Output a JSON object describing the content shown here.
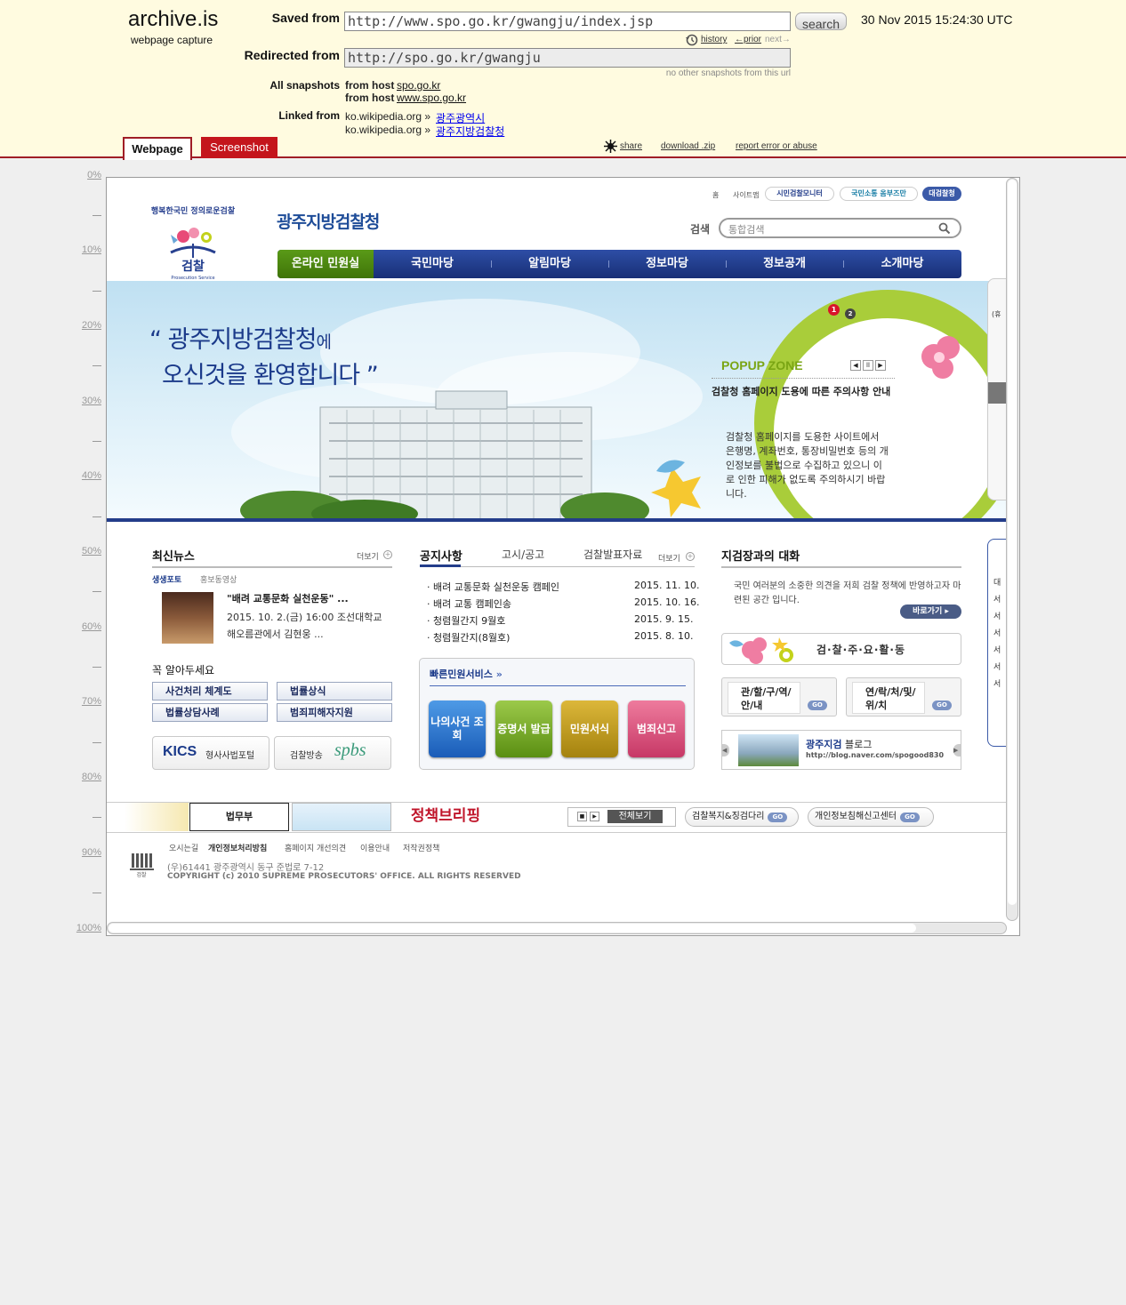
{
  "archive": {
    "logo": "archive.is",
    "logo_sub": "webpage capture",
    "saved_label": "Saved from",
    "saved_url": "http://www.spo.go.kr/gwangju/index.jsp",
    "search_label": "search",
    "timestamp": "30 Nov 2015 15:24:30 UTC",
    "history": "history",
    "prior": "←prior",
    "next": "next→",
    "redirected_label": "Redirected from",
    "redirected_url": "http://spo.go.kr/gwangju",
    "no_other": "no other snapshots from this url",
    "all_snapshots_label": "All snapshots",
    "from_host": "from host",
    "host1": "spo.go.kr",
    "host2": "www.spo.go.kr",
    "linked_label": "Linked from",
    "linked": [
      {
        "prefix": "ko.wikipedia.org »",
        "link": "광주광역시"
      },
      {
        "prefix": "ko.wikipedia.org »",
        "link": "광주지방검찰청"
      }
    ],
    "tab_webpage": "Webpage",
    "tab_screenshot": "Screenshot",
    "share": "share",
    "download": "download .zip",
    "report": "report error or abuse"
  },
  "ruler": [
    "0%",
    "10%",
    "20%",
    "30%",
    "40%",
    "50%",
    "60%",
    "70%",
    "80%",
    "90%",
    "100%"
  ],
  "site": {
    "util_links": [
      "홈",
      "사이트맵"
    ],
    "util_buttons": [
      "시민검찰모니터",
      "국민소통 옴부즈만",
      "대검찰청"
    ],
    "title": "광주지방검찰청",
    "logo_arc": "행복한국민 정의로운검찰",
    "logo_name": "검찰",
    "logo_en": "Prosecution Service",
    "search_label": "검색",
    "search_placeholder": "통합검색",
    "nav": [
      "온라인 민원실",
      "국민마당",
      "알림마당",
      "정보마당",
      "정보공개",
      "소개마당"
    ],
    "welcome_line1": "“ 광주지방검찰청",
    "welcome_line1_suffix": "에",
    "welcome_line2": "오신것을 환영합니다 ”",
    "popup": {
      "title": "POPUP ZONE",
      "pages": [
        "1",
        "2"
      ],
      "heading": "검찰청 홈페이지 도용에 따른 주의사항 안내",
      "body": "검찰청 홈페이지를 도용한 사이트에서 은행명, 계좌번호, 통장비밀번호 등의 개인정보를 불법으로 수집하고 있으니 이로 인한 피해가 없도록 주의하시기 바랍니다."
    },
    "news": {
      "title": "최신뉴스",
      "more": "더보기",
      "tabs": [
        "생생포토",
        "홍보동영상"
      ],
      "headline": "\"배려 교통문화 실천운동\" ...",
      "body": "2015. 10. 2.(금) 16:00 조선대학교 해오름관에서 김현웅 ..."
    },
    "notice": {
      "tabs": [
        "공지사항",
        "고시/공고",
        "검찰발표자료"
      ],
      "more": "더보기",
      "items": [
        {
          "title": "배려 교통문화 실천운동 캠페인",
          "date": "2015. 11. 10."
        },
        {
          "title": "배려 교통 캠페인송",
          "date": "2015. 10. 16."
        },
        {
          "title": "청렴월간지 9월호",
          "date": "2015. 9. 15."
        },
        {
          "title": "청렴월간지(8월호)",
          "date": "2015. 8. 10."
        }
      ]
    },
    "dialog": {
      "title": "지검장과의 대화",
      "body": "국민 여러분의 소중한 의견을 저희 검찰 정책에 반영하고자 마련된 공간 입니다.",
      "button": "바로가기"
    },
    "must_know": {
      "title": "꼭 알아두세요",
      "items": [
        "사건처리 체계도",
        "법률상식",
        "법률상담사례",
        "범죄피해자지원"
      ]
    },
    "portals": [
      "형사사법포털",
      "검찰방송"
    ],
    "portal_logos": [
      "KICS",
      "spbs"
    ],
    "quick": {
      "title": "빠른민원서비스",
      "items": [
        "나의사건 조회",
        "증명서 발급",
        "민원서식",
        "범죄신고"
      ]
    },
    "activities": "검·찰·주·요·활·동",
    "jurisdiction": "관/할/구/역/안/내",
    "contact": "연/락/처/및/위/치",
    "go": "GO",
    "blog_title": "광주지검",
    "blog_sub": "블로그",
    "blog_url": "http://blog.naver.com/spogood830",
    "banners": [
      "법무부",
      "정책브리핑",
      "전체보기",
      "검찰복지&징검다리",
      "개인정보침해신고센터"
    ],
    "footer_links": [
      "오시는길",
      "개인정보처리방침",
      "홈페이지 개선의견",
      "이용안내",
      "저작권정책"
    ],
    "address": "(우)61441 광주광역시 동구 준법로 7-12",
    "copyright": "COPYRIGHT (c) 2010 SUPREME PROSECUTORS' OFFICE. ALL RIGHTS RESERVED",
    "side_labels": [
      "(휴",
      [
        "대",
        "서",
        "서",
        "서",
        "서",
        "서",
        "서"
      ]
    ]
  },
  "colors": {
    "archive_bg": "#fffbe0",
    "archive_red": "#a01d26",
    "nav_blue": "#233d8a",
    "nav_green": "#4f8a12"
  }
}
